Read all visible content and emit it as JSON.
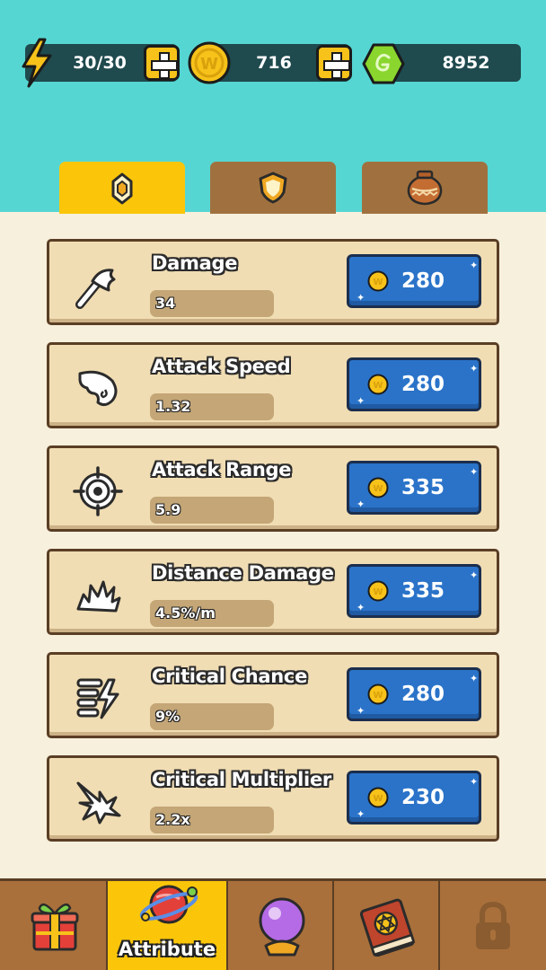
{
  "resources": {
    "energy": "30/30",
    "coins": "716",
    "gems": "8952"
  },
  "tabs": [
    {
      "name": "attribute-tab",
      "icon": "rank-badge-icon",
      "active": true
    },
    {
      "name": "defense-tab",
      "icon": "shield-icon",
      "active": false
    },
    {
      "name": "relics-tab",
      "icon": "pot-icon",
      "active": false
    }
  ],
  "upgrades": [
    {
      "title": "Damage",
      "value": "34",
      "price": "280",
      "icon": "torch-icon"
    },
    {
      "title": "Attack Speed",
      "value": "1.32",
      "price": "280",
      "icon": "wing-icon"
    },
    {
      "title": "Attack Range",
      "value": "5.9",
      "price": "335",
      "icon": "crosshair-icon"
    },
    {
      "title": "Distance Damage",
      "value": "4.5%/m",
      "price": "335",
      "icon": "burst-icon"
    },
    {
      "title": "Critical Chance",
      "value": "9%",
      "price": "280",
      "icon": "lightning-stack-icon"
    },
    {
      "title": "Critical Multiplier",
      "value": "2.2x",
      "price": "230",
      "icon": "impact-arrow-icon"
    }
  ],
  "nav": {
    "active_label": "Attribute"
  },
  "colors": {
    "sky": "#56d6d2",
    "panel": "#f7f0dc",
    "card": "#f1ddb3",
    "active_tab": "#fbc60a",
    "inactive_tab": "#a0713f",
    "buy_button": "#2a73c9"
  }
}
